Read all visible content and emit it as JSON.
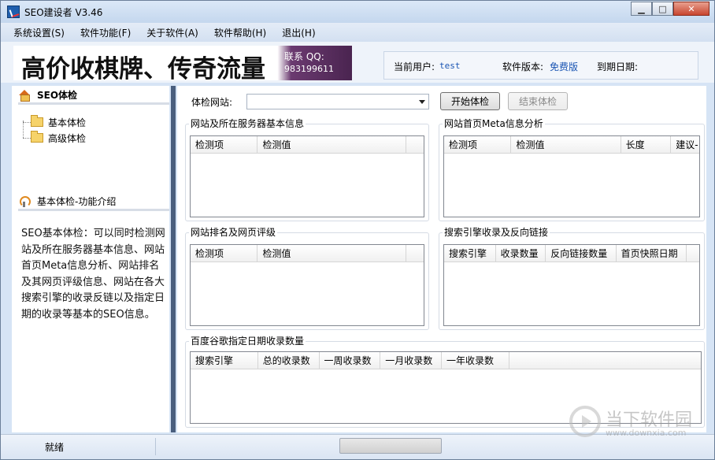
{
  "window": {
    "title": "SEO建设者 V3.46",
    "min_btn": "▁",
    "max_btn": "□",
    "close_btn": "✕"
  },
  "menu": [
    "系统设置(S)",
    "软件功能(F)",
    "关于软件(A)",
    "软件帮助(H)",
    "退出(H)"
  ],
  "banner": {
    "slogan": "高价收棋牌、传奇流量",
    "contact_label": "联系 QQ:",
    "contact_number": "983199611"
  },
  "user_info": {
    "current_user_label": "当前用户:",
    "current_user_value": "test",
    "version_label": "软件版本:",
    "version_value": "免费版",
    "expiry_label": "到期日期:",
    "expiry_value": ""
  },
  "left_panel": {
    "section_title": "SEO体检",
    "tree": [
      "基本体检",
      "高级体检"
    ],
    "intro_title": "基本体检-功能介绍",
    "intro_text": "SEO基本体检：可以同时检测网站及所在服务器基本信息、网站首页Meta信息分析、网站排名及其网页评级信息、网站在各大搜索引擎的收录反链以及指定日期的收录等基本的SEO信息。"
  },
  "check": {
    "label": "体检网站:",
    "selected_value": "",
    "start_button": "开始体检",
    "stop_button": "结束体检"
  },
  "groups": {
    "server": {
      "title": "网站及所在服务器基本信息",
      "columns": [
        "检测项",
        "检测值",
        ""
      ]
    },
    "meta": {
      "title": "网站首页Meta信息分析",
      "columns": [
        "检测项",
        "检测值",
        "长度",
        "建议-"
      ]
    },
    "rank": {
      "title": "网站排名及网页评级",
      "columns": [
        "检测项",
        "检测值",
        ""
      ]
    },
    "index": {
      "title": "搜索引擎收录及反向链接",
      "columns": [
        "搜索引擎",
        "收录数量",
        "反向链接数量",
        "首页快照日期",
        ""
      ]
    },
    "dated": {
      "title": "百度谷歌指定日期收录数量",
      "columns": [
        "搜索引擎",
        "总的收录数",
        "一周收录数",
        "一月收录数",
        "一年收录数",
        ""
      ]
    }
  },
  "statusbar": {
    "status": "就绪"
  },
  "watermark": {
    "text": "当下软件园",
    "url": "www.downxia.com"
  }
}
